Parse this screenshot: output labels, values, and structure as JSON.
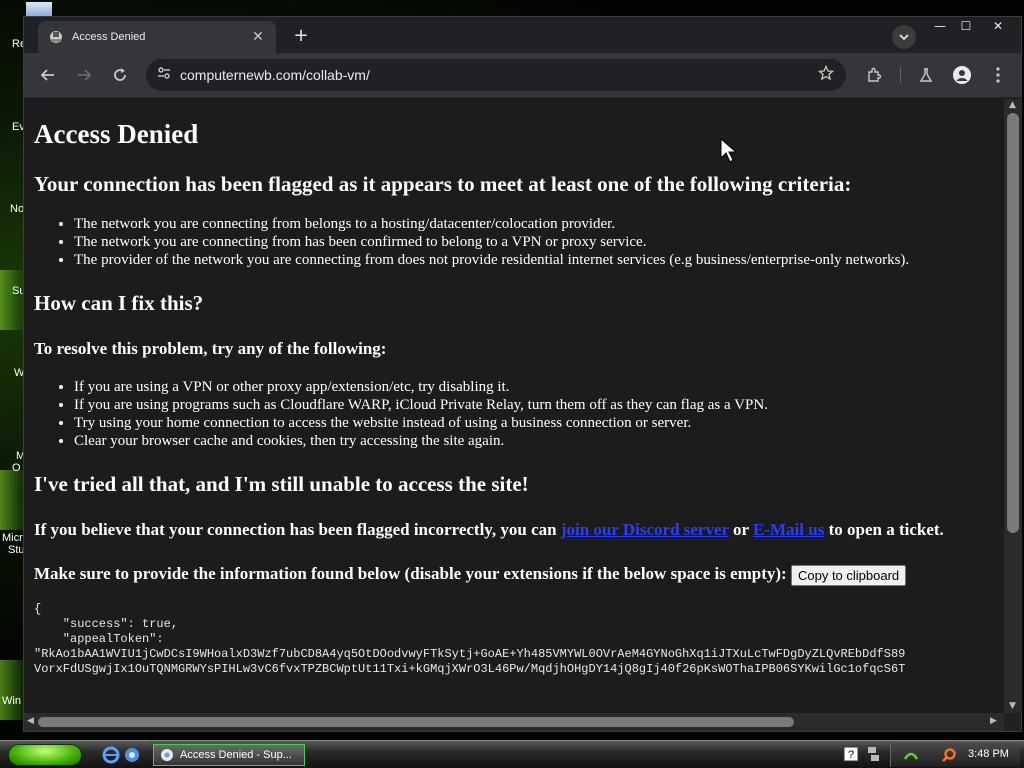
{
  "desktop": {
    "icon_labels": [
      "Re",
      "Ev",
      "No",
      "Su",
      "W",
      "M",
      "O",
      "Micro",
      "Stu",
      "Win"
    ]
  },
  "browser": {
    "tab_title": "Access Denied",
    "url": "computernewb.com/collab-vm/"
  },
  "page": {
    "h1": "Access Denied",
    "criteria_heading": "Your connection has been flagged as it appears to meet at least one of the following criteria:",
    "criteria": [
      "The network you are connecting from belongs to a hosting/datacenter/colocation provider.",
      "The network you are connecting from has been confirmed to belong to a VPN or proxy service.",
      "The provider of the network you are connecting from does not provide residential internet services (e.g business/enterprise-only networks)."
    ],
    "fix_heading": "How can I fix this?",
    "resolve_heading": "To resolve this problem, try any of the following:",
    "fixes": [
      "If you are using a VPN or other proxy app/extension/etc, try disabling it.",
      "If you are using programs such as Cloudflare WARP, iCloud Private Relay, turn them off as they can flag as a VPN.",
      "Try using your home connection to access the website instead of using a business connection or server.",
      "Clear your browser cache and cookies, then try accessing the site again."
    ],
    "tried_heading": "I've tried all that, and I'm still unable to access the site!",
    "incorrect_prefix": "If you believe that your connection has been flagged incorrectly, you can ",
    "discord_link": "join our Discord server",
    "incorrect_or": " or ",
    "email_link": "E-Mail us",
    "incorrect_suffix": " to open a ticket.",
    "provide_info": "Make sure to provide the information found below (disable your extensions if the below space is empty): ",
    "copy_button": "Copy to clipboard",
    "code_lines": [
      "{",
      "    \"success\": true,",
      "    \"appealToken\":",
      "\"RkAo1bAA1WVIU1jCwDCsI9WHoalxD3Wzf7ubCD8A4yq5OtDOodvwyFTkSytj+GoAE+Yh485VMYWL0OVrAeM4GYNoGhXq1iJTXuLcTwFDgDyZLQvREbDdfS89",
      "VorxFdUSgwjIx1OuTQNMGRWYsPIHLw3vC6fvxTPZBCWptUt11Txi+kGMqjXWrO3L46Pw/MqdjhOHgDY14jQ8gIj40f26pKsWOThaIPB06SYKwilGc1ofqcS6T"
    ]
  },
  "taskbar": {
    "window_title": "Access Denied - Sup...",
    "clock": "3:48 PM"
  }
}
